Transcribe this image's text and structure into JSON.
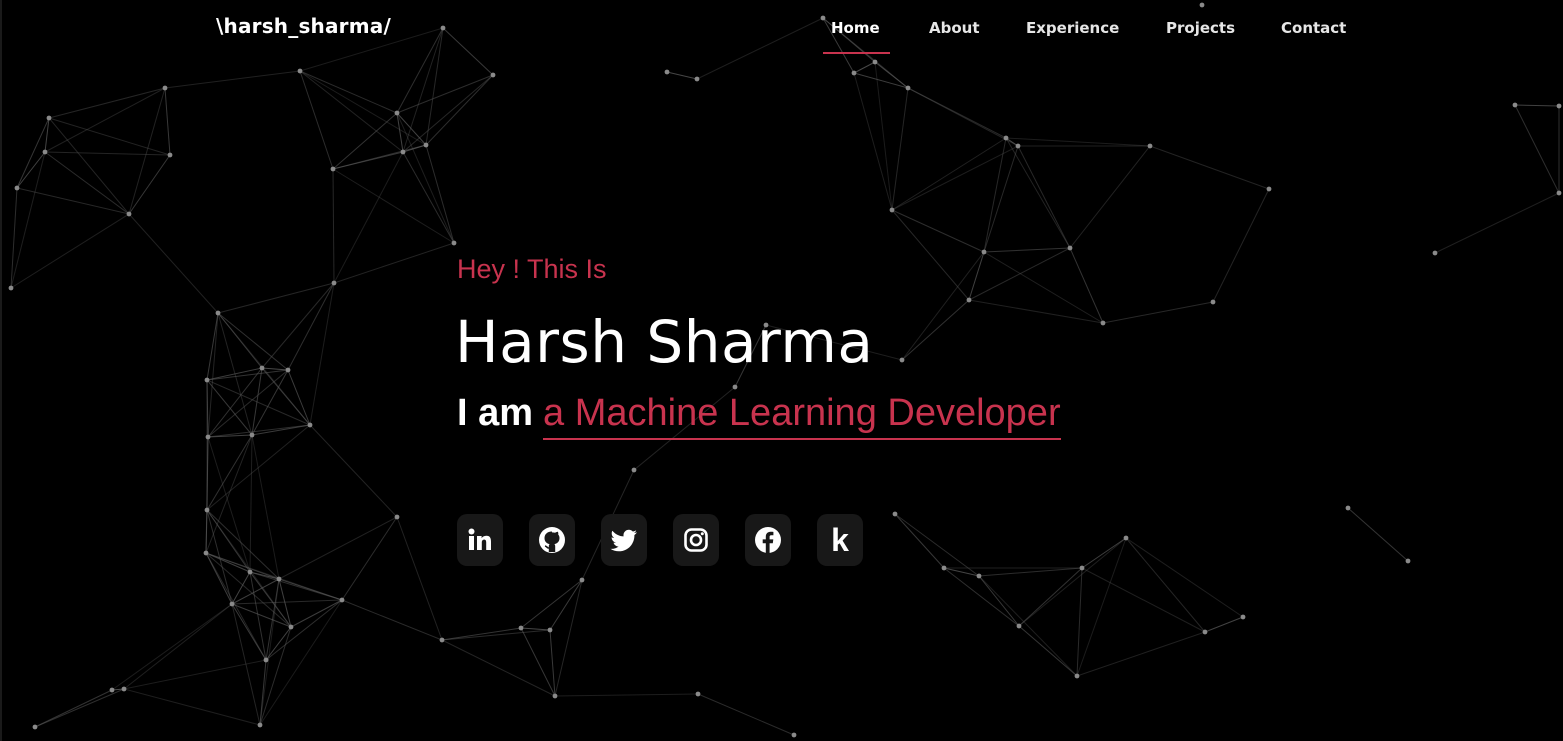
{
  "nav": {
    "brand": "\\harsh_sharma/",
    "links": [
      {
        "label": "Home",
        "active": true
      },
      {
        "label": "About",
        "active": false
      },
      {
        "label": "Experience",
        "active": false
      },
      {
        "label": "Projects",
        "active": false
      },
      {
        "label": "Contact",
        "active": false
      }
    ]
  },
  "hero": {
    "greeting": "Hey ! This Is",
    "name": "Harsh Sharma",
    "role_prefix": "I am",
    "role_text": "a Machine Learning Developer"
  },
  "socials": [
    {
      "icon": "linkedin-icon"
    },
    {
      "icon": "github-icon"
    },
    {
      "icon": "twitter-icon"
    },
    {
      "icon": "instagram-icon"
    },
    {
      "icon": "facebook-icon"
    },
    {
      "icon": "kaggle-icon",
      "glyph": "k"
    }
  ],
  "colors": {
    "background": "#000000",
    "accent": "#c8334e",
    "text": "#ffffff",
    "icon_bg": "#181818",
    "particle_line": "#5a5a5a",
    "particle_dot": "#8a8a8a"
  }
}
